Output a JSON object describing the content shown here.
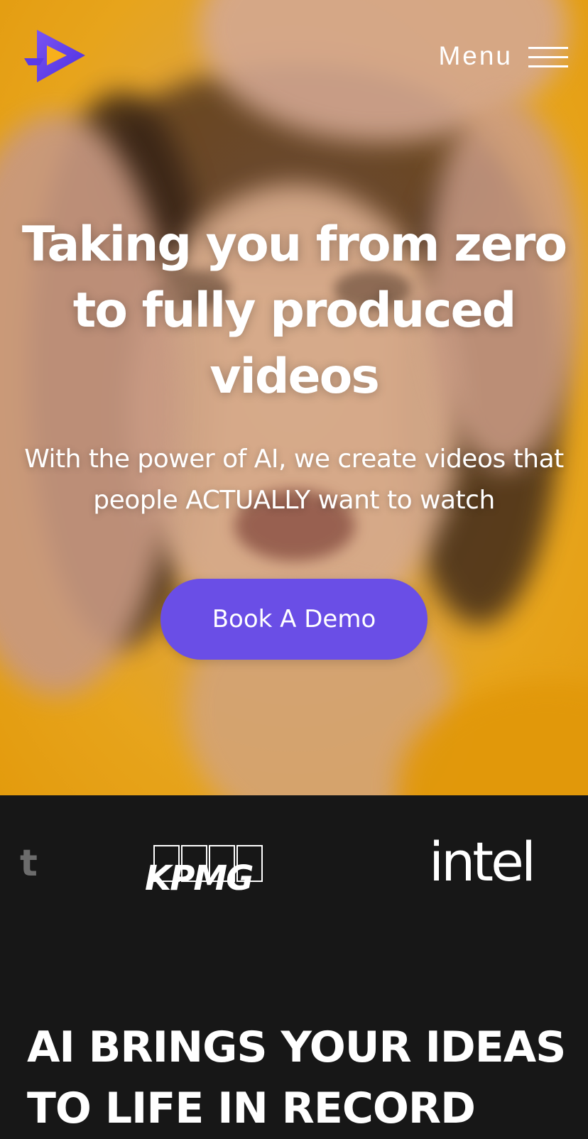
{
  "header": {
    "logo_name": "play-logo",
    "menu_label": "Menu",
    "menu_icon": "hamburger-icon"
  },
  "hero": {
    "headline": "Taking you from zero to fully produced videos",
    "subhead": "With the power of AI, we create videos that people ACTUALLY want to watch",
    "cta_label": "Book A Demo",
    "cta_color": "#6a4ee6",
    "background_color": "#fbb21f"
  },
  "clients": {
    "partial_logo_text": "t",
    "logos": [
      "KPMG",
      "intel"
    ]
  },
  "section": {
    "title": "AI BRINGS YOUR IDEAS TO LIFE IN RECORD"
  }
}
